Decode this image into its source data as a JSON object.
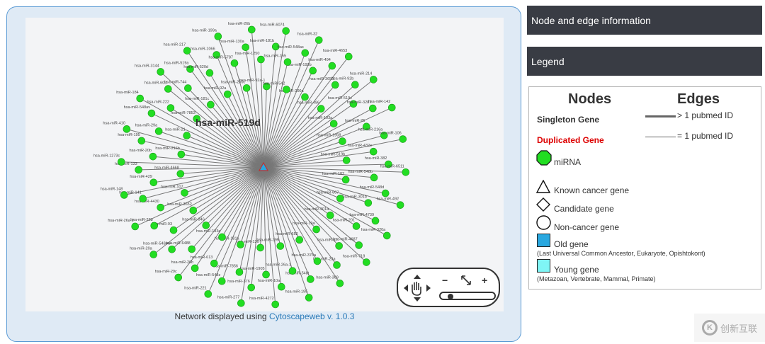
{
  "network": {
    "center_label": "hsa-miR-519d",
    "caption_prefix": "Network displayed using ",
    "caption_link": "Cytoscapeweb v. 1.0.3",
    "node_color": "#22dd22",
    "edge_color": "#777777",
    "mirnas": [
      "hsa-miR-32",
      "hsa-miR-193b",
      "hsa-miR-200a",
      "hsa-miR-494",
      "hsa-miR-4653",
      "hsa-miR-3653",
      "hsa-miR-486",
      "hsa-miR-92b",
      "hsa-miR-214",
      "hsa-miR-519c",
      "hsa-miR-193a",
      "hsa-miR-3287",
      "hsa-miR-142",
      "hsa-miR-25",
      "hsa-miR-1908",
      "hsa-miR-216a",
      "hsa-miR-106",
      "hsa-miR-432e",
      "hsa-miR-519b",
      "hsa-miR-382",
      "hsa-miR-6511",
      "hsa-miR-548b",
      "hsa-miR-182",
      "hsa-miR-548d",
      "hsa-miR-492",
      "hsa-miR-301b",
      "hsa-miR-607",
      "hsa-miR-4739",
      "hsa-miR-320a",
      "hsa-miR-201",
      "hsa-miR-301a",
      "hsa-miR-4687",
      "hsa-miR-718",
      "hsa-miR-17",
      "hsa-miR-19a",
      "hsa-miR-23a",
      "hsa-miR-369",
      "hsa-miR-376a",
      "hsa-miR-652",
      "hsa-miR-548t",
      "hsa-miR-195",
      "hsa-miR-26a-1",
      "hsa-miR-295",
      "hsa-miR-10a",
      "hsa-miR-4272",
      "hsa-miR-1905",
      "hsa-miR-136",
      "hsa-miR-376",
      "hsa-miR-277",
      "hsa-miR-7856",
      "hsa-miR-181a",
      "hsa-miR-548z",
      "hsa-miR-221",
      "hsa-miR-613",
      "hsa-miR-193e",
      "hsa-miR-26b",
      "hsa-miR-29c",
      "hsa-miR-6488",
      "hsa-miR-346",
      "hsa-miR-548ew",
      "hsa-miR-20a",
      "hsa-miR-93",
      "hsa-miR-3652",
      "hsa-miR-23b",
      "hsa-miR-26a-2",
      "hsa-miR-4430",
      "hsa-miR-107",
      "hsa-miR-141",
      "hsa-miR-148",
      "hsa-miR-429",
      "hsa-miR-4668",
      "hsa-miR-133",
      "hsa-miR-1273c",
      "hsa-miR-20b",
      "hsa-miR-216b",
      "hsa-miR-195",
      "hsa-miR-410",
      "hsa-miR-29a",
      "hsa-miR-21",
      "hsa-miR-548av",
      "hsa-miR-184",
      "hsa-miR-222",
      "hsa-miR-7853",
      "hsa-miR-603",
      "hsa-miR-3144",
      "hsa-miR-744",
      "hsa-miR-181c",
      "hsa-miR-519a",
      "hsa-miR-217",
      "hsa-miR-520d",
      "hsa-miR-92a",
      "hsa-miR-1066",
      "hsa-miR-199a",
      "hsa-miR-5787",
      "hsa-miR-200c",
      "hsa-miR-130a",
      "hsa-miR-26b",
      "hsa-miR-1250",
      "hsa-miR-92a-1",
      "hsa-miR-181b",
      "hsa-miR-6074",
      "hsa-miR-155",
      "hsa-miR-542",
      "hsa-miR-548as"
    ]
  },
  "panels": {
    "node_edge_title": "Node and edge information",
    "legend_title": "Legend"
  },
  "legend": {
    "nodes_header": "Nodes",
    "edges_header": "Edges",
    "singleton": "Singleton Gene",
    "duplicated": "Duplicated Gene",
    "duplicated_color": "#dd0000",
    "mirna": "miRNA",
    "known_cancer": "Known cancer gene",
    "candidate": "Candidate gene",
    "non_cancer": "Non-cancer gene",
    "old_gene": "Old gene",
    "old_gene_desc": "(Last Universal Common Ancestor, Eukaryote, Opishtokont)",
    "old_color": "#29a8e0",
    "young_gene": "Young gene",
    "young_gene_desc": "(Metazoan, Vertebrate, Mammal, Primate)",
    "young_color": "#7ff5f5",
    "edge_thick": "> 1 pubmed ID",
    "edge_thin": "= 1 pubmed ID"
  },
  "watermark": {
    "icon": "K",
    "text": "创新互联"
  }
}
